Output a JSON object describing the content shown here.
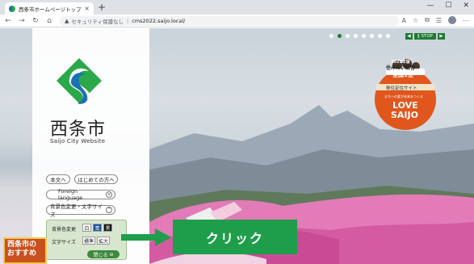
{
  "browser": {
    "tab_title": "西条市ホームページトップページ",
    "tab_close": "×",
    "new_tab": "+",
    "window_controls": [
      "—",
      "☐",
      "✕"
    ],
    "address": {
      "security_label": "セキュリティ保護なし",
      "separator": "|",
      "url": "cms2022.saijo.local/"
    },
    "icons": [
      "back-icon",
      "forward-icon",
      "reload-icon",
      "home-icon",
      "star-icon",
      "extensions-icon",
      "profile-icon",
      "menu-icon"
    ]
  },
  "site": {
    "logo_name": "西条市",
    "logo_subtitle": "Saijo City Website",
    "buttons": {
      "main_text": "本文へ",
      "beginners": "はじめての方へ",
      "foreign_language": "Foreign language",
      "color_text": "背景色変更・文字サイズ"
    },
    "settings": {
      "bg_label": "背景色変更",
      "bg_options": [
        "白",
        "青",
        "黒"
      ],
      "text_size_label": "文字サイズ",
      "text_size_options": [
        "標準",
        "拡大"
      ],
      "close_label": "閉じる"
    },
    "slider": {
      "dot_count": 8,
      "active_index": 1,
      "stop_label": "STOP"
    },
    "badge": {
      "line1": "2021年版",
      "line2": "住みたい田舎",
      "line3": "全国1位",
      "line4": "移住定住サイト",
      "line5": "まちへの愛が未来をつくる",
      "line6": "LOVE",
      "line7": "SAIJO"
    }
  },
  "overlay": {
    "promo_text": "西条市の おすすめ",
    "click_label": "クリック"
  },
  "colors": {
    "brand_green": "#1f7a33",
    "click_green": "#1e9e4b",
    "badge_orange": "#e0561d"
  }
}
